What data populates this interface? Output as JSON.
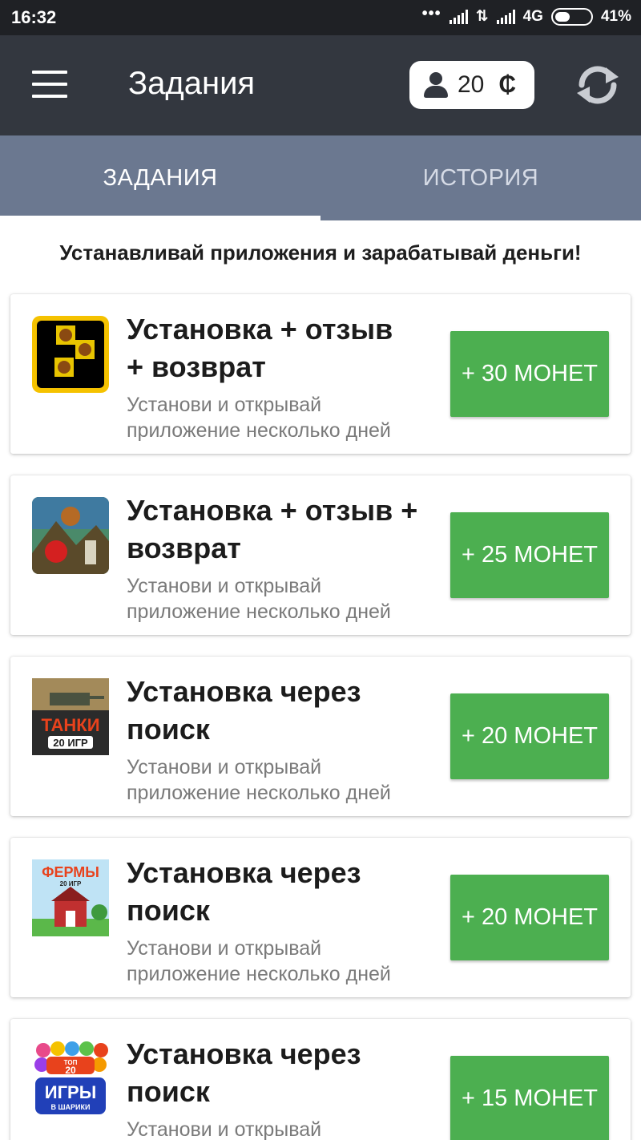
{
  "status_bar": {
    "time": "16:32",
    "dots": "•••",
    "network": "4G",
    "battery": "41%"
  },
  "app_bar": {
    "title": "Задания",
    "coin_balance": "20",
    "coin_symbol": "₵"
  },
  "tabs": [
    {
      "label": "ЗАДАНИЯ",
      "active": true
    },
    {
      "label": "ИСТОРИЯ",
      "active": false
    }
  ],
  "subtitle": "Устанавливай приложения и зарабатывай деньги!",
  "tasks": [
    {
      "icon": "monkey-puzzle-game-icon",
      "title": "Установка  + отзыв\n+ возврат",
      "description": "Установи и открывай приложение несколько дней",
      "reward": "+ 30 МОНЕТ"
    },
    {
      "icon": "jungle-monkey-game-icon",
      "title": "Установка + отзыв +\nвозврат",
      "description": "Установи и открывай приложение несколько дней",
      "reward": "+ 25 МОНЕТ"
    },
    {
      "icon": "tanks-game-icon",
      "title": "Установка через\nпоиск",
      "description": "Установи и открывай приложение несколько дней",
      "reward": "+ 20 МОНЕТ",
      "icon_text": [
        "ТАНКИ",
        "20 ИГР"
      ]
    },
    {
      "icon": "farms-game-icon",
      "title": "Установка через\nпоиск",
      "description": "Установи и открывай приложение несколько дней",
      "reward": "+ 20 МОНЕТ",
      "icon_text": [
        "ФЕРМЫ",
        "20 ИГР"
      ]
    },
    {
      "icon": "bubble-games-icon",
      "title": "Установка через\nпоиск",
      "description": "Установи и открывай",
      "reward": "+ 15 МОНЕТ",
      "icon_text": [
        "ТОП",
        "20",
        "ИГРЫ",
        "В ШАРИКИ"
      ]
    }
  ],
  "colors": {
    "status_bar": "#1f2125",
    "app_bar": "#33373f",
    "tab_bar": "#6b7890",
    "reward_button": "#4caf50"
  }
}
